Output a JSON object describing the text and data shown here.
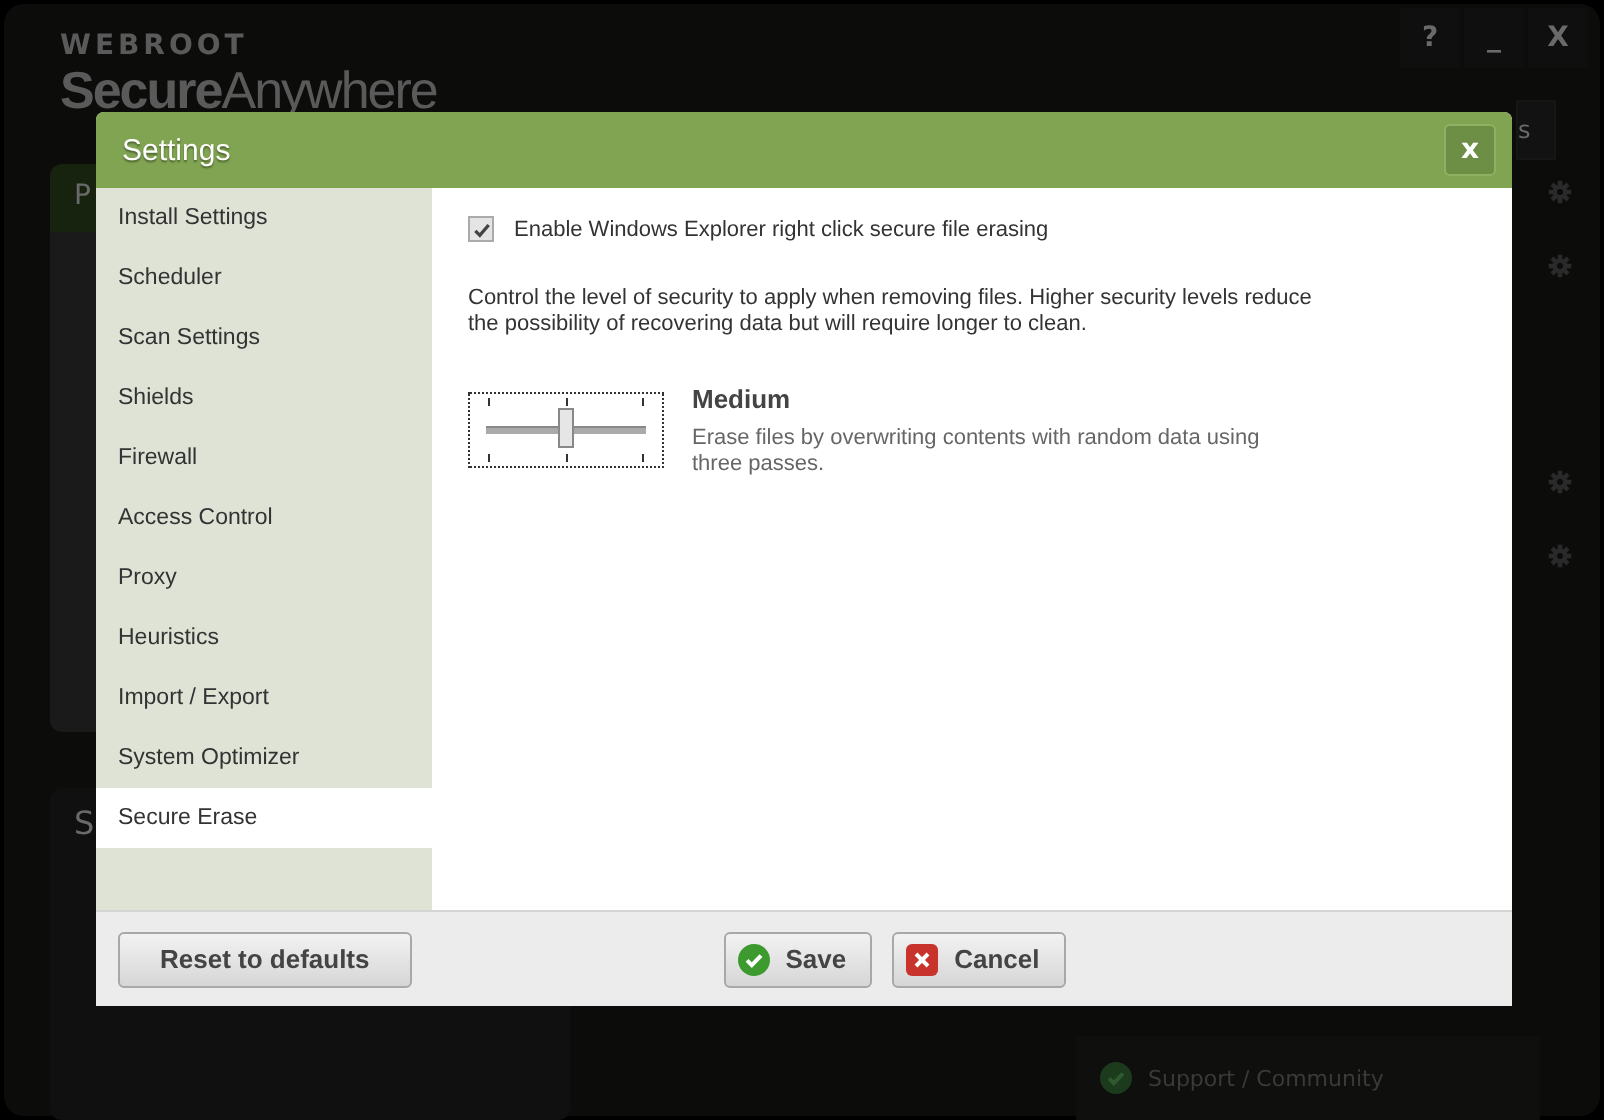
{
  "app": {
    "brand": "WEBROOT",
    "product": "Secure",
    "product_suffix": "Anywhere",
    "window_buttons": [
      "?",
      "_",
      "X"
    ],
    "button_fragment": "s",
    "panels": [
      {
        "title": "P"
      },
      {
        "title": "S"
      }
    ],
    "link": "Support / Community"
  },
  "dialog": {
    "title": "Settings",
    "close": "x",
    "sidebar": {
      "items": [
        {
          "label": "Install Settings",
          "selected": false
        },
        {
          "label": "Scheduler",
          "selected": false
        },
        {
          "label": "Scan Settings",
          "selected": false
        },
        {
          "label": "Shields",
          "selected": false
        },
        {
          "label": "Firewall",
          "selected": false
        },
        {
          "label": "Access Control",
          "selected": false
        },
        {
          "label": "Proxy",
          "selected": false
        },
        {
          "label": "Heuristics",
          "selected": false
        },
        {
          "label": "Import / Export",
          "selected": false
        },
        {
          "label": "System Optimizer",
          "selected": false
        },
        {
          "label": "Secure Erase",
          "selected": true
        }
      ]
    },
    "checkbox": {
      "label": "Enable Windows Explorer right click secure file erasing",
      "checked": true
    },
    "description": "Control the level of security to apply when removing files. Higher security levels reduce the possibility of recovering data but will require longer to clean.",
    "security": {
      "level": 0.5,
      "name": "Medium",
      "description": "Erase files by overwriting contents with random data using three passes."
    },
    "buttons": [
      {
        "label": "Reset to defaults",
        "kind": "plain"
      },
      {
        "label": "Save",
        "kind": "save"
      },
      {
        "label": "Cancel",
        "kind": "cancel"
      }
    ]
  }
}
